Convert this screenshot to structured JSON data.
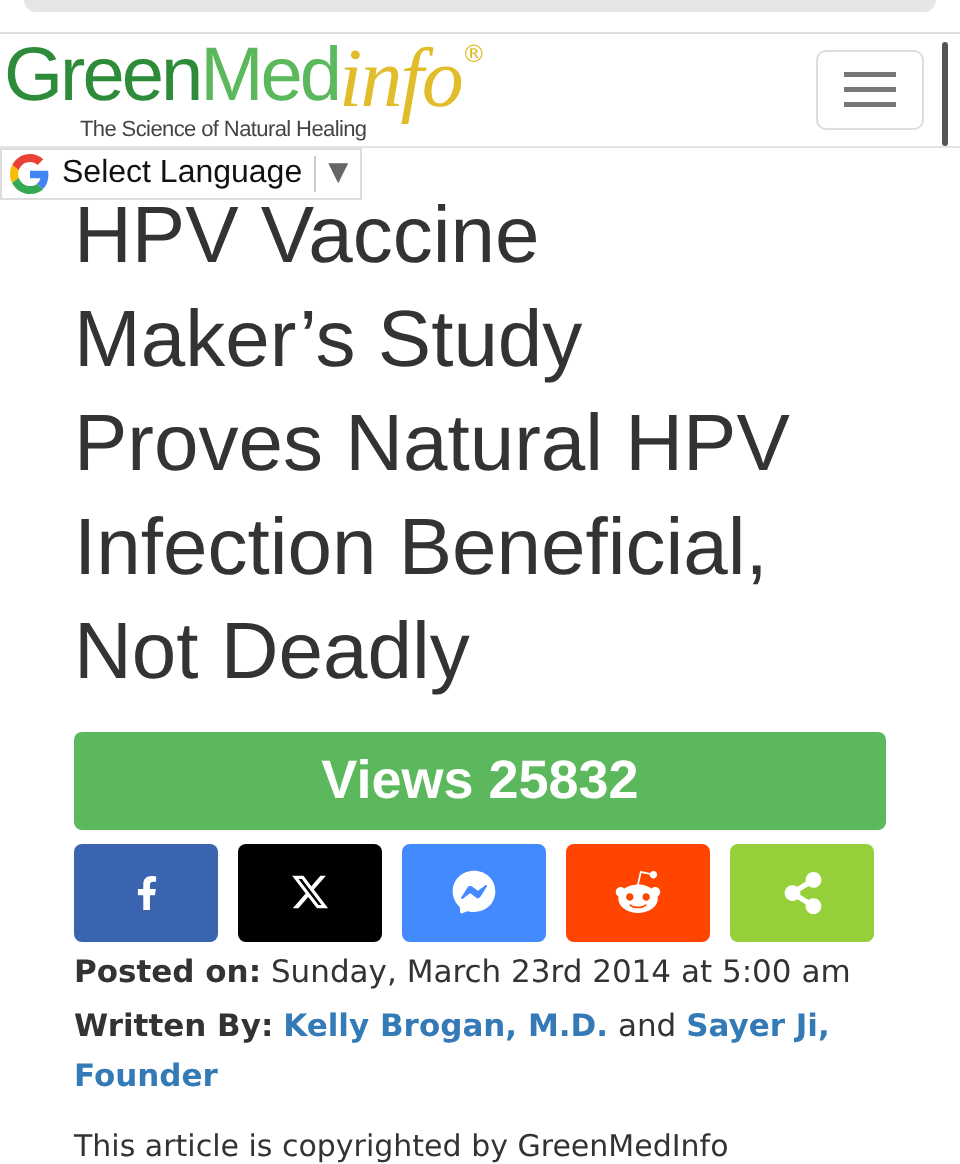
{
  "header": {
    "logo": {
      "part_1": "Green",
      "part_2": "Med",
      "part_3": "info",
      "mark": "®",
      "tagline": "The Science of Natural Healing"
    }
  },
  "language_selector": {
    "label": "Select Language",
    "caret": "▼"
  },
  "article": {
    "title_lines": [
      "HPV Vaccine",
      "Maker’s Study",
      "Proves Natural HPV",
      "Infection Beneficial,",
      "Not Deadly"
    ],
    "views": "Views 25832",
    "share_buttons": [
      {
        "kind": "facebook",
        "color": "#3b64b0"
      },
      {
        "kind": "x",
        "color": "#000000"
      },
      {
        "kind": "messenger",
        "color": "#448aff"
      },
      {
        "kind": "reddit",
        "color": "#ff4500"
      },
      {
        "kind": "share",
        "color": "#95d03a"
      }
    ],
    "posted_label": "Posted on:",
    "posted_value": "Sunday, March 23rd 2014 at 5:00 am",
    "written_label": "Written By:",
    "authors": [
      {
        "lines": [
          "Kelly Brogan, M.D."
        ]
      },
      {
        "lines": [
          "Sayer Ji,",
          "Founder"
        ]
      }
    ],
    "author_joiner": "and",
    "body": "This article is copyrighted by GreenMedInfo"
  }
}
